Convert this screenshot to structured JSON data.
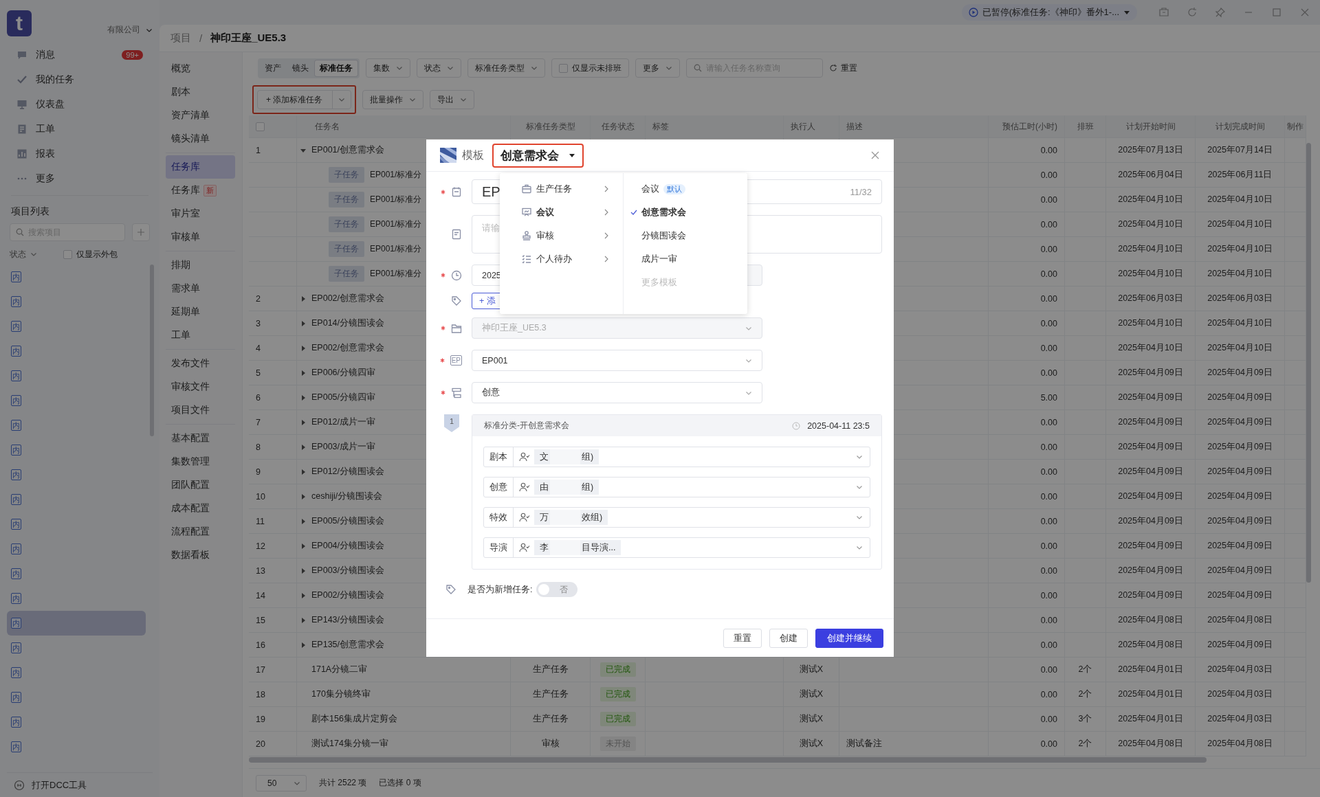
{
  "titlebar": {
    "task_status": "已暂停(标准任务:《神印》番外1-..."
  },
  "sidebar": {
    "logo": "t",
    "company": "有限公司",
    "menu": [
      {
        "label": "消息",
        "badge": "99+"
      },
      {
        "label": "我的任务"
      },
      {
        "label": "仪表盘"
      },
      {
        "label": "工单"
      },
      {
        "label": "报表"
      },
      {
        "label": "更多"
      }
    ],
    "project_list": {
      "title": "项目列表",
      "search_placeholder": "搜索项目",
      "status_filter": "状态",
      "outsource_only": {
        "label": "仅显示外包",
        "checked": false
      },
      "items": [
        {
          "badge": "内",
          "selected": false
        },
        {
          "badge": "内",
          "selected": false
        },
        {
          "badge": "内",
          "selected": false
        },
        {
          "badge": "内",
          "selected": false
        },
        {
          "badge": "内",
          "selected": false
        },
        {
          "badge": "内",
          "selected": false
        },
        {
          "badge": "内",
          "selected": false
        },
        {
          "badge": "内",
          "selected": false
        },
        {
          "badge": "内",
          "selected": false
        },
        {
          "badge": "内",
          "selected": false
        },
        {
          "badge": "内",
          "selected": false
        },
        {
          "badge": "内",
          "selected": false
        },
        {
          "badge": "内",
          "selected": false
        },
        {
          "badge": "内",
          "selected": false
        },
        {
          "badge": "内",
          "selected": true
        },
        {
          "badge": "内",
          "selected": false
        },
        {
          "badge": "内",
          "selected": false
        },
        {
          "badge": "内",
          "selected": false
        },
        {
          "badge": "内",
          "selected": false
        },
        {
          "badge": "内",
          "selected": false
        }
      ]
    },
    "footer": "打开DCC工具"
  },
  "breadcrumb": {
    "items": [
      "项目",
      "神印王座_UE5.3"
    ],
    "separator": "/"
  },
  "nav": [
    [
      {
        "label": "概览",
        "selected": false
      },
      {
        "label": "剧本",
        "selected": false
      },
      {
        "label": "资产清单",
        "selected": false
      },
      {
        "label": "镜头清单",
        "selected": false
      }
    ],
    [
      {
        "label": "任务库",
        "selected": true
      },
      {
        "label": "任务库",
        "selected": false,
        "badge": "新"
      },
      {
        "label": "审片室",
        "selected": false
      },
      {
        "label": "审核单",
        "selected": false
      }
    ],
    [
      {
        "label": "排期",
        "selected": false
      },
      {
        "label": "需求单",
        "selected": false
      },
      {
        "label": "延期单",
        "selected": false
      },
      {
        "label": "工单",
        "selected": false
      }
    ],
    [
      {
        "label": "发布文件",
        "selected": false
      },
      {
        "label": "审核文件",
        "selected": false
      },
      {
        "label": "项目文件",
        "selected": false
      }
    ],
    [
      {
        "label": "基本配置",
        "selected": false
      },
      {
        "label": "集数管理",
        "selected": false
      },
      {
        "label": "团队配置",
        "selected": false
      },
      {
        "label": "成本配置",
        "selected": false
      },
      {
        "label": "流程配置",
        "selected": false
      },
      {
        "label": "数据看板",
        "selected": false
      }
    ]
  ],
  "toolbar": {
    "segments": [
      {
        "label": "资产",
        "selected": false
      },
      {
        "label": "镜头",
        "selected": false
      },
      {
        "label": "标准任务",
        "selected": true
      }
    ],
    "filters": [
      "集数",
      "状态",
      "标准任务类型"
    ],
    "unscheduled_only": {
      "label": "仅显示未排班",
      "checked": false
    },
    "more": "更多",
    "search_placeholder": "请输入任务名称查询",
    "reset": "重置",
    "add_button": "+ 添加标准任务",
    "batch": "批量操作",
    "export": "导出"
  },
  "table": {
    "select_all": {
      "checked": false
    },
    "columns": [
      "任务名",
      "标准任务类型",
      "任务状态",
      "标签",
      "执行人",
      "描述",
      "预估工时(小时)",
      "排班",
      "计划开始时间",
      "计划完成时间",
      "制作"
    ],
    "rows": [
      {
        "index": "1",
        "name": "EP001/创意需求会",
        "expanded": true,
        "est": "0.00",
        "start": "2025年07月13日",
        "end": "2025年07月14日",
        "children": [
          {
            "tag": "子任务",
            "name": "EP001/标准分",
            "est": "0.00",
            "start": "2025年06月04日",
            "end": "2025年06月11日"
          },
          {
            "tag": "子任务",
            "name": "EP001/标准分",
            "est": "0.00",
            "start": "2025年04月10日",
            "end": "2025年04月10日"
          },
          {
            "tag": "子任务",
            "name": "EP001/标准分",
            "est": "0.00",
            "start": "2025年04月10日",
            "end": "2025年04月10日"
          },
          {
            "tag": "子任务",
            "name": "EP001/标准分",
            "est": "0.00",
            "start": "2025年04月10日",
            "end": "2025年04月10日"
          },
          {
            "tag": "子任务",
            "name": "EP001/标准分",
            "est": "0.00",
            "start": "2025年04月10日",
            "end": "2025年04月10日"
          }
        ]
      },
      {
        "index": "2",
        "name": "EP002/创意需求会",
        "expanded": false,
        "est": "0.00",
        "start": "2025年06月03日",
        "end": "2025年06月03日"
      },
      {
        "index": "3",
        "name": "EP014/分镜围读会",
        "expanded": false,
        "est": "0.00",
        "start": "2025年04月10日",
        "end": "2025年04月10日"
      },
      {
        "index": "4",
        "name": "EP002/创意需求会",
        "expanded": false,
        "est": "0.00",
        "start": "2025年04月10日",
        "end": "2025年04月10日"
      },
      {
        "index": "5",
        "name": "EP006/分镜四审",
        "expanded": false,
        "est": "0.00",
        "start": "2025年04月09日",
        "end": "2025年04月09日"
      },
      {
        "index": "6",
        "name": "EP005/分镜四审",
        "expanded": false,
        "est": "5.00",
        "start": "2025年04月09日",
        "end": "2025年04月09日"
      },
      {
        "index": "7",
        "name": "EP012/成片一审",
        "expanded": false,
        "est": "0.00",
        "start": "2025年04月09日",
        "end": "2025年04月09日"
      },
      {
        "index": "8",
        "name": "EP003/成片一审",
        "expanded": false,
        "est": "0.00",
        "start": "2025年04月09日",
        "end": "2025年04月09日"
      },
      {
        "index": "9",
        "name": "EP012/分镜围读会",
        "expanded": false,
        "est": "0.00",
        "start": "2025年04月09日",
        "end": "2025年04月09日"
      },
      {
        "index": "10",
        "name": "ceshiji/分镜围读会",
        "expanded": false,
        "est": "0.00",
        "start": "2025年04月09日",
        "end": "2025年04月09日"
      },
      {
        "index": "11",
        "name": "EP005/分镜围读会",
        "expanded": false,
        "est": "0.00",
        "start": "2025年04月09日",
        "end": "2025年04月09日"
      },
      {
        "index": "12",
        "name": "EP004/分镜围读会",
        "expanded": false,
        "est": "0.00",
        "start": "2025年04月09日",
        "end": "2025年04月09日"
      },
      {
        "index": "13",
        "name": "EP003/分镜围读会",
        "expanded": false,
        "est": "0.00",
        "start": "2025年04月09日",
        "end": "2025年04月09日"
      },
      {
        "index": "14",
        "name": "EP002/分镜围读会",
        "expanded": false,
        "est": "0.00",
        "start": "2025年04月09日",
        "end": "2025年04月09日"
      },
      {
        "index": "15",
        "name": "EP143/分镜围读会",
        "expanded": false,
        "est": "0.00",
        "start": "2025年04月08日",
        "end": "2025年04月08日"
      },
      {
        "index": "16",
        "name": "EP135/创意需求会",
        "expanded": false,
        "est": "0.00",
        "start": "2025年04月08日",
        "end": "2025年04月09日"
      },
      {
        "index": "17",
        "name": "171A分镜二审",
        "type": "生产任务",
        "status": {
          "text": "已完成",
          "kind": "done"
        },
        "executor": "测试X",
        "est": "0.00",
        "schedule": "2个",
        "start": "2025年04月01日",
        "end": "2025年04月03日"
      },
      {
        "index": "18",
        "name": "170集分镜终审",
        "type": "生产任务",
        "status": {
          "text": "已完成",
          "kind": "done"
        },
        "executor": "测试X",
        "est": "0.00",
        "schedule": "2个",
        "start": "2025年04月01日",
        "end": "2025年04月03日"
      },
      {
        "index": "19",
        "name": "剧本156集成片定剪会",
        "type": "生产任务",
        "status": {
          "text": "已完成",
          "kind": "done"
        },
        "executor": "测试X",
        "est": "0.00",
        "schedule": "3个",
        "start": "2025年04月01日",
        "end": "2025年04月03日"
      },
      {
        "index": "20",
        "name": "测试174集分镜一审",
        "type": "审核",
        "status": {
          "text": "未开始",
          "kind": "not_started"
        },
        "executor": "测试X",
        "desc": "测试备注",
        "est": "0.00",
        "schedule": "2个",
        "start": "2025年04月08日",
        "end": "2025年04月08日"
      }
    ]
  },
  "pagination": {
    "page_size": "50",
    "total": "共计 2522 项",
    "selected": "已选择 0 项"
  },
  "modal": {
    "title_label": "模板",
    "template": "创意需求会",
    "fields": [
      {
        "kind": "input",
        "required": true,
        "value": "EP",
        "counter": "11/32"
      },
      {
        "kind": "textarea",
        "required": false,
        "placeholder": "请输"
      },
      {
        "kind": "date",
        "required": true,
        "value": "2025"
      },
      {
        "kind": "tag_button",
        "required": false,
        "label": "+ 添"
      },
      {
        "kind": "select",
        "required": true,
        "value": "神印王座_UE5.3",
        "disabled": true
      },
      {
        "kind": "select",
        "required": true,
        "value": "EP001",
        "disabled": false,
        "icon_label": "EP"
      },
      {
        "kind": "select",
        "required": true,
        "value": "创意",
        "disabled": false
      }
    ],
    "section": {
      "number": "1",
      "title": "标准分类-开创意需求会",
      "deadline": "2025-04-11 23:5",
      "roles": [
        {
          "role": "剧本",
          "assignee": "文",
          "group": "组)"
        },
        {
          "role": "创意",
          "assignee": "由",
          "group": "组)"
        },
        {
          "role": "特效",
          "assignee": "万",
          "group": "效组)"
        },
        {
          "role": "导演",
          "assignee": "李",
          "group": "目导演..."
        }
      ]
    },
    "new_task": {
      "label": "是否为新增任务:",
      "on": false,
      "off_text": "否"
    },
    "buttons": [
      {
        "label": "重置",
        "primary": false
      },
      {
        "label": "创建",
        "primary": false
      },
      {
        "label": "创建并继续",
        "primary": true
      }
    ],
    "dropdown": {
      "categories": [
        {
          "label": "生产任务",
          "selected": false
        },
        {
          "label": "会议",
          "selected": true
        },
        {
          "label": "审核",
          "selected": false
        },
        {
          "label": "个人待办",
          "selected": false
        }
      ],
      "templates": [
        {
          "label": "会议",
          "badge": "默认",
          "selected": false,
          "disabled": false
        },
        {
          "label": "创意需求会",
          "selected": true,
          "disabled": false
        },
        {
          "label": "分镜围读会",
          "selected": false,
          "disabled": false
        },
        {
          "label": "成片一审",
          "selected": false,
          "disabled": false
        },
        {
          "label": "更多模板",
          "selected": false,
          "disabled": true
        }
      ]
    }
  }
}
